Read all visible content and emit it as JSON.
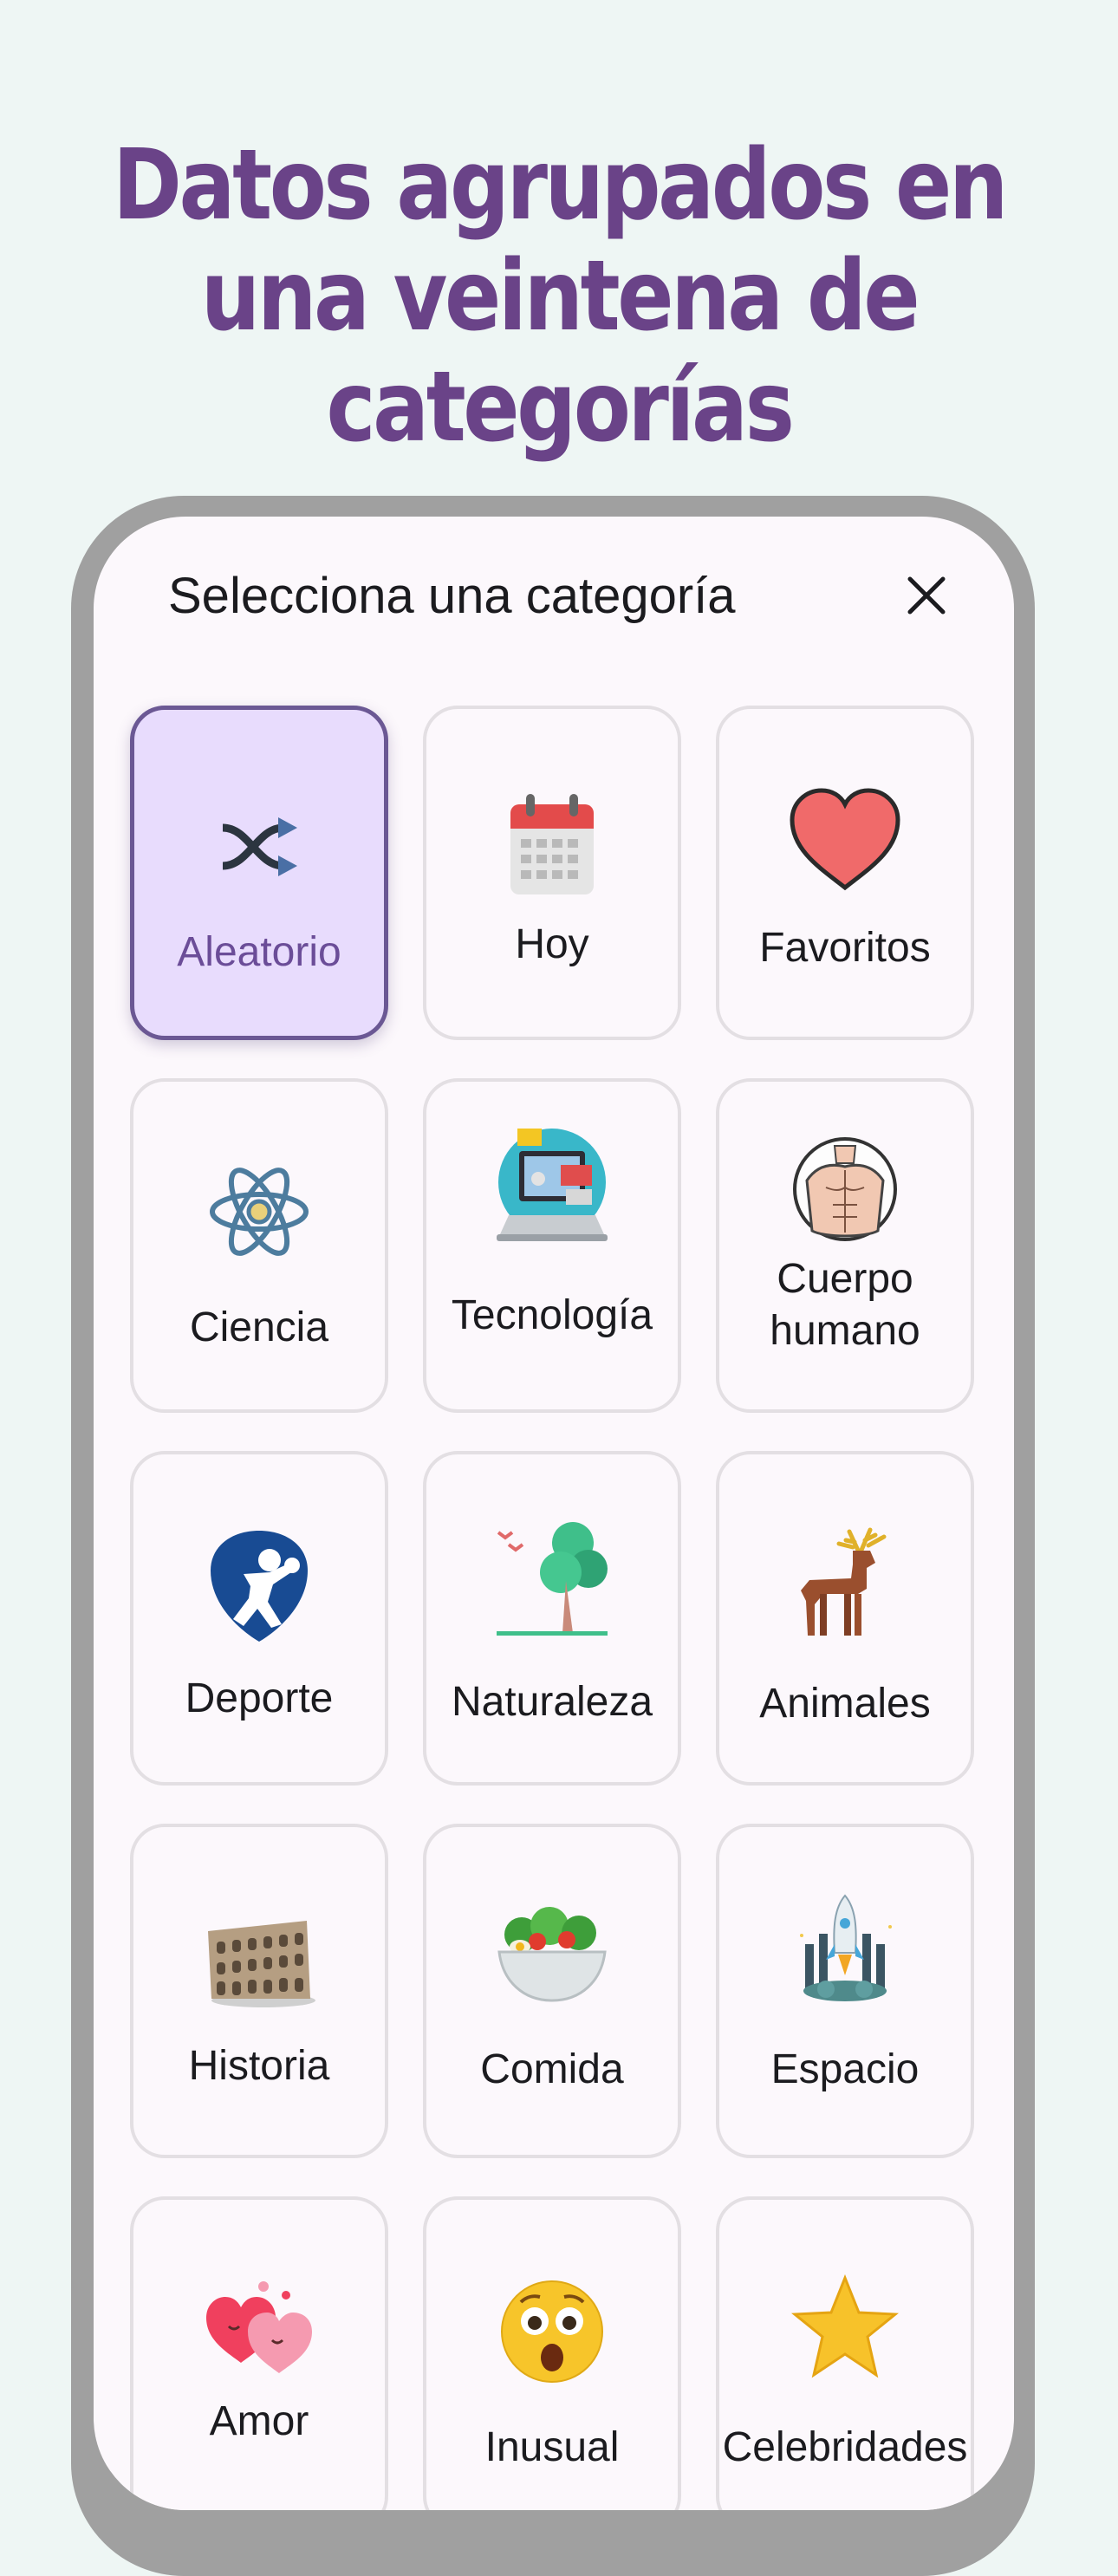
{
  "headline": {
    "line1": "Datos agrupados en",
    "line2": "una veintena de",
    "line3": "categorías"
  },
  "sheet": {
    "title": "Selecciona una categoría",
    "close_icon": "close-icon"
  },
  "colors": {
    "background": "#eef6f4",
    "headline": "#6a4388",
    "selected_tile": "#e8dcfd",
    "selected_border": "#6b5894"
  },
  "categories": [
    {
      "label": "Aleatorio",
      "icon": "shuffle-icon",
      "selected": true
    },
    {
      "label": "Hoy",
      "icon": "calendar-icon"
    },
    {
      "label": "Favoritos",
      "icon": "heart-icon"
    },
    {
      "label": "Ciencia",
      "icon": "atom-icon"
    },
    {
      "label": "Tecnología",
      "icon": "computer-icon"
    },
    {
      "label": "Cuerpo",
      "label2": "humano",
      "icon": "human-torso-icon"
    },
    {
      "label": "Deporte",
      "icon": "boxing-icon"
    },
    {
      "label": "Naturaleza",
      "icon": "tree-icon"
    },
    {
      "label": "Animales",
      "icon": "deer-icon"
    },
    {
      "label": "Historia",
      "icon": "colosseum-icon"
    },
    {
      "label": "Comida",
      "icon": "salad-icon"
    },
    {
      "label": "Espacio",
      "icon": "rocket-icon"
    },
    {
      "label": "Amor",
      "icon": "hearts-icon"
    },
    {
      "label": "Inusual",
      "icon": "astonished-face-icon"
    },
    {
      "label": "Celebridades",
      "icon": "star-icon"
    }
  ]
}
